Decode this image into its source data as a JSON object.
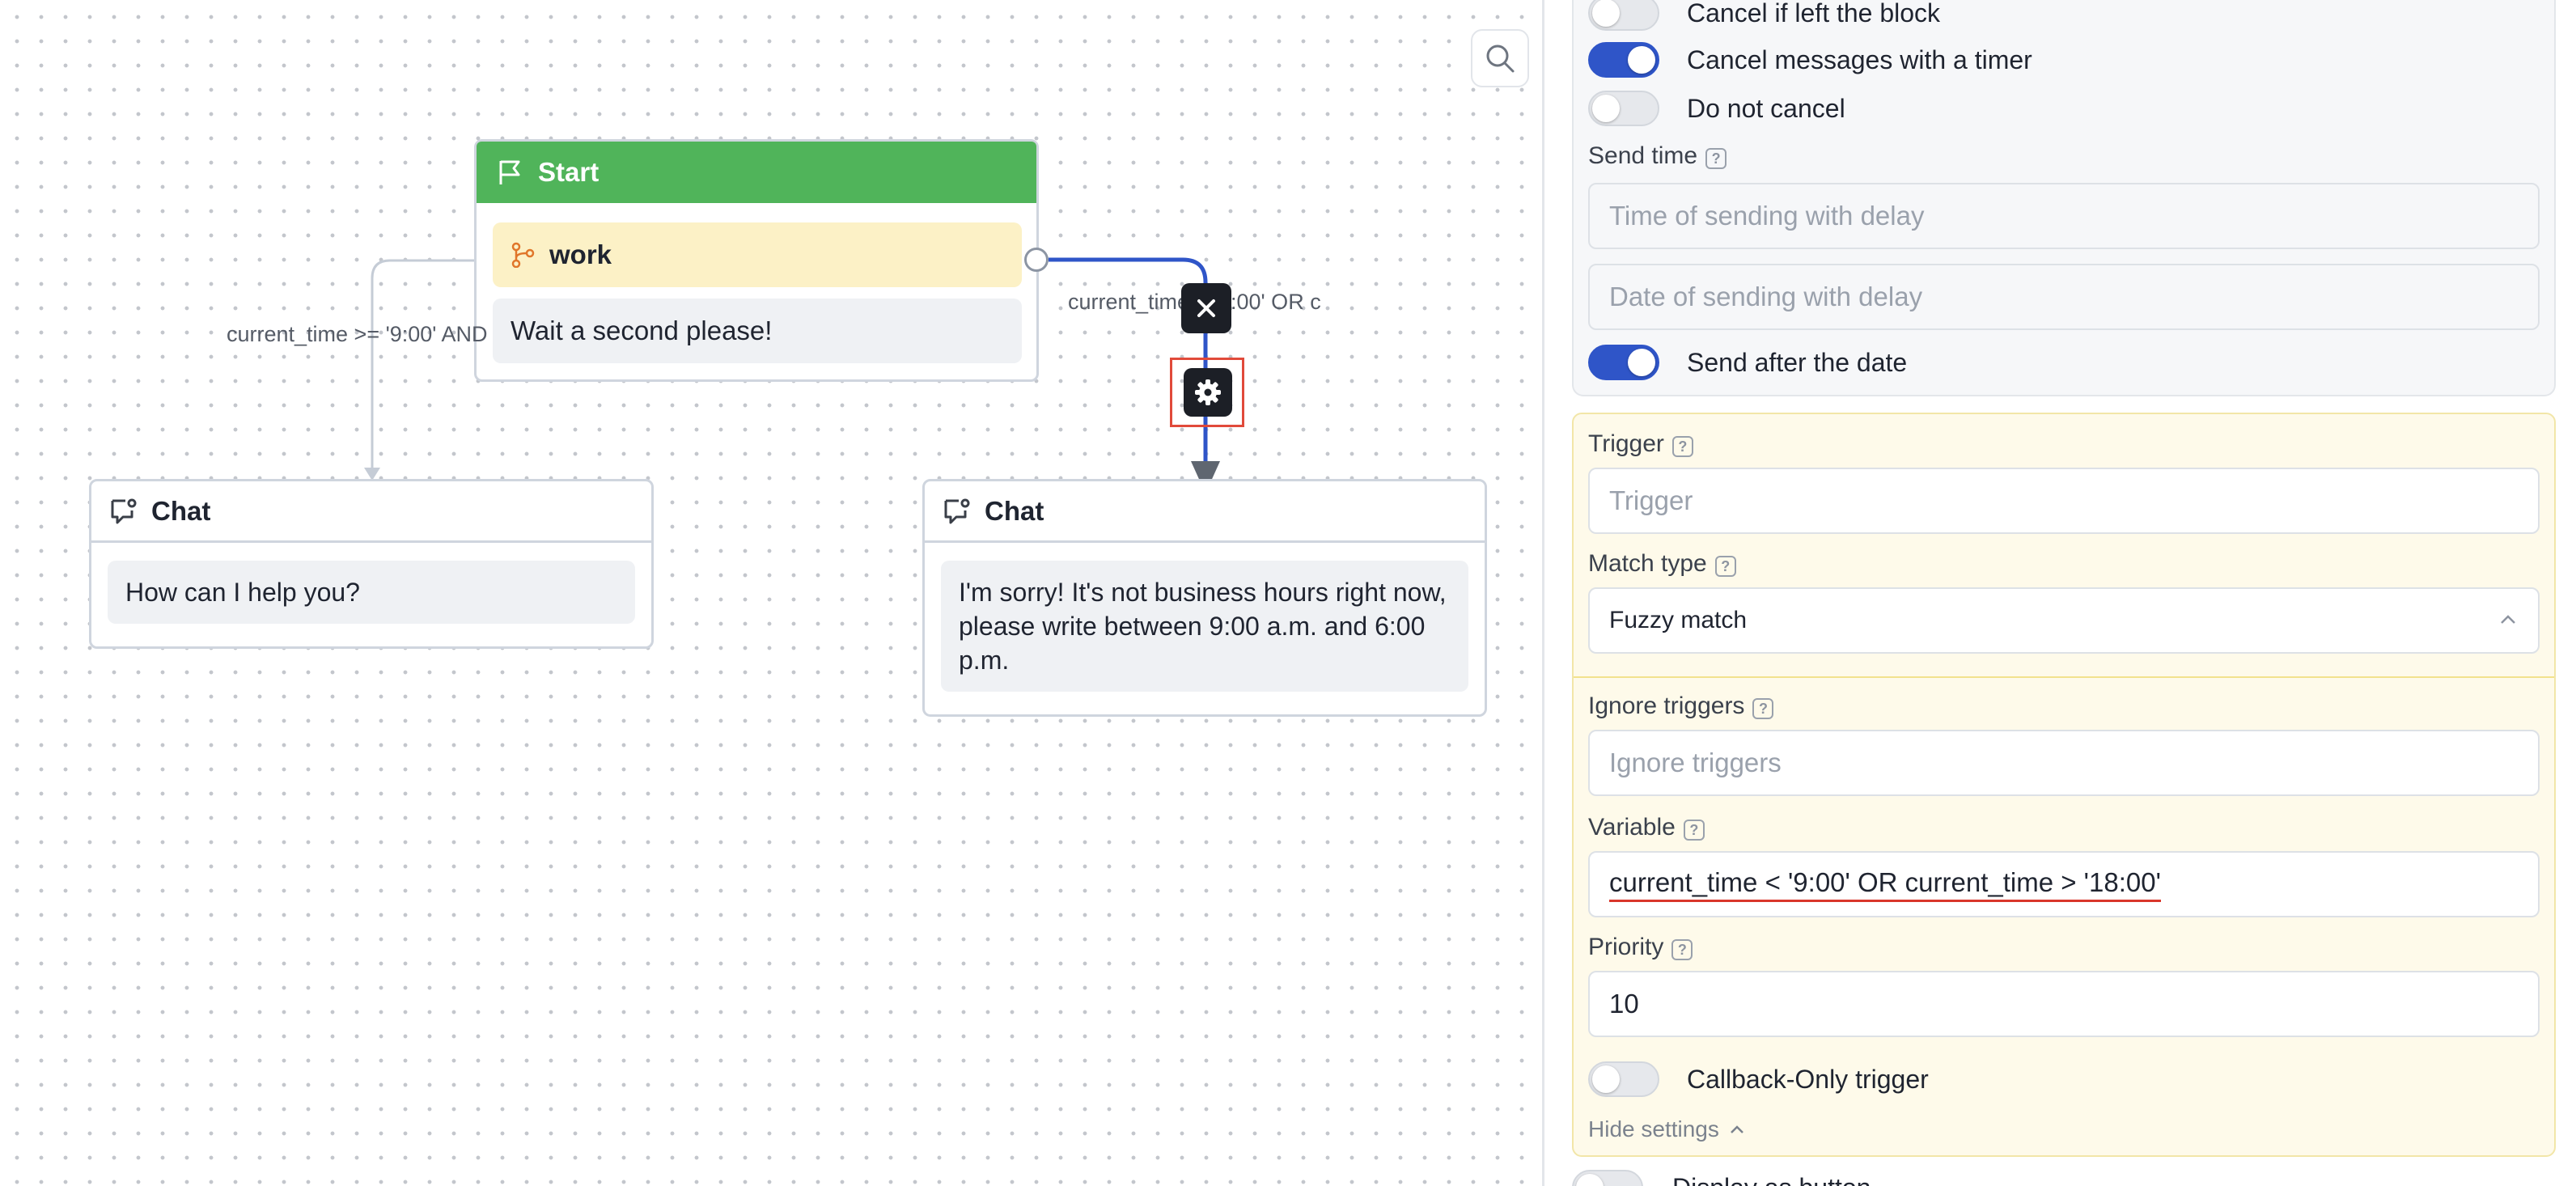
{
  "canvas": {
    "start_node": {
      "title": "Start",
      "condition_name": "work",
      "message": "Wait a second please!"
    },
    "edge_labels": {
      "left": "current_time >= '9:00' AND",
      "right": "current_time < '9:00' OR c"
    },
    "chat_left": {
      "title": "Chat",
      "message": "How can I help you?"
    },
    "chat_right": {
      "title": "Chat",
      "message": "I'm sorry! It's not business hours right now, please write between 9:00 a.m. and 6:00 p.m."
    }
  },
  "panel": {
    "toggles_top": [
      {
        "label": "Cancel if left the block",
        "on": false
      },
      {
        "label": "Cancel messages with a timer",
        "on": true
      },
      {
        "label": "Do not cancel",
        "on": false
      }
    ],
    "send_time": {
      "label": "Send time",
      "time_placeholder": "Time of sending with delay",
      "date_placeholder": "Date of sending with delay"
    },
    "send_after_date": {
      "label": "Send after the date",
      "on": true
    },
    "trigger": {
      "label": "Trigger",
      "placeholder": "Trigger"
    },
    "match_type": {
      "label": "Match type",
      "value": "Fuzzy match"
    },
    "ignore_triggers": {
      "label": "Ignore triggers",
      "placeholder": "Ignore triggers"
    },
    "variable": {
      "label": "Variable",
      "value": "current_time < '9:00' OR current_time > '18:00'"
    },
    "priority": {
      "label": "Priority",
      "value": "10"
    },
    "callback_only": {
      "label": "Callback-Only trigger",
      "on": false
    },
    "hide_settings": "Hide settings",
    "display_as_button": "Display as button",
    "help_glyph": "?"
  },
  "colors": {
    "start_header": "#50b45a",
    "condition_row": "#fcf1c6",
    "active_edge": "#2f55c8",
    "toggle_on": "#2f55c8",
    "highlight_box": "#e14a3a"
  }
}
